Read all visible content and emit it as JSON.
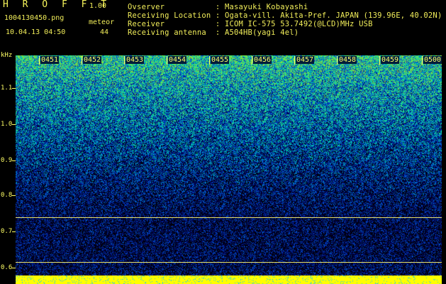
{
  "app": {
    "title_letters": "H R O F F T",
    "version": "1.00",
    "filename": "1004130450.png",
    "meteor_label": "meteor",
    "date_time": "10.04.13 04:50",
    "meteor_count": "44"
  },
  "station": {
    "observer": "Ovserver           : Masayuki Kobayashi",
    "location": "Receiving Location : Ogata-vill. Akita-Pref. JAPAN (139.96E, 40.02N)",
    "receiver": "Receiver           : ICOM IC-575 53.7492(@LCD)MHz USB",
    "antenna": "Receiving antenna  : A504HB(yagi 4el)"
  },
  "axis": {
    "unit": "kHz",
    "y_ticks": [
      "1.1",
      "1.0",
      "0.9",
      "0.8",
      "0.7",
      "0.6"
    ],
    "time_labels": [
      "0451",
      "0452",
      "0453",
      "0454",
      "0455",
      "0456",
      "0457",
      "0458",
      "0459",
      "0500"
    ]
  },
  "colors": {
    "text": "#f2ee5a",
    "background": "#000000",
    "marker_lines": "#e7e06c",
    "bottom_bar": "#ffff00"
  }
}
